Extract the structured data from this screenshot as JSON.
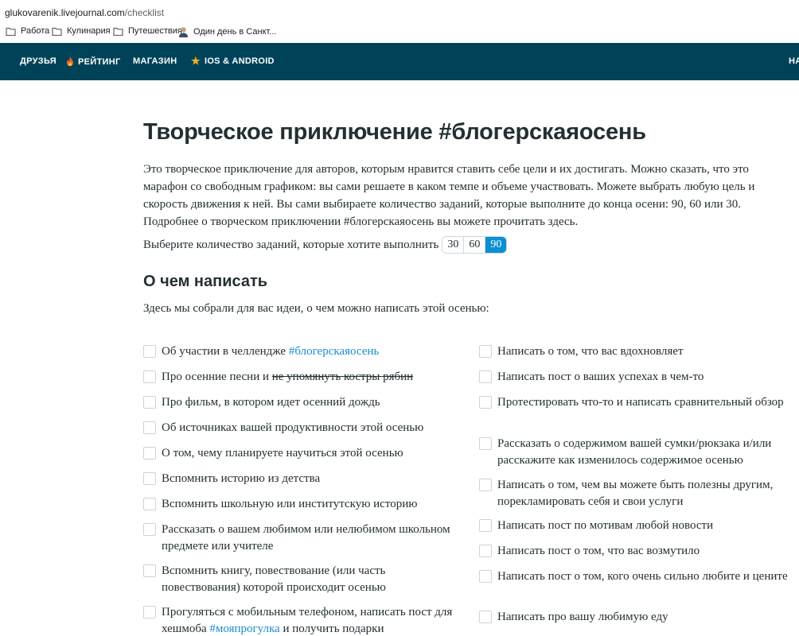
{
  "browser": {
    "url_host": "glukovarenik.livejournal.com",
    "url_path": "/checklist",
    "bookmarks": [
      "Работа",
      "Кулинария",
      "Путешествия",
      "Один день в Санкт..."
    ]
  },
  "nav": {
    "items": [
      "ДРУЗЬЯ",
      "РЕЙТИНГ",
      "МАГАЗИН",
      "IOS & ANDROID"
    ],
    "right_fragment": "НА"
  },
  "page": {
    "title": "Творческое приключение #блогерскаяосень",
    "intro": [
      "Это творческое приключение для авторов, которым нравится ставить себе цели и их достигать. Можно сказать, что это марафон со свободным графиком: вы сами решаете в каком темпе и объеме участвовать. Можете выбрать любую цель и скорость движения к ней. Вы сами выбираете количество заданий, которые выполните до конца осени: 90, 60 или 30.",
      "Подробнее о творческом приключении #блогерскаяосень вы можете прочитать здесь."
    ],
    "chooser": {
      "label": "Выберите количество заданий, которые хотите выполнить",
      "options": [
        "30",
        "60",
        "90"
      ],
      "selected": "90"
    },
    "section_title": "О чем написать",
    "section_lead": "Здесь мы собрали для вас идеи, о чем можно написать этой осенью:"
  },
  "checklist": {
    "left": [
      {
        "text": "Об участии в челлендже ",
        "tag": "#блогерскаяосень",
        "checked": false
      },
      {
        "text": "Про осенние песни и ",
        "strike": "не упомянуть костры рябин",
        "checked": false
      },
      {
        "text": "Про фильм, в котором идет осенний дождь",
        "checked": false
      },
      {
        "text": "Об источниках вашей продуктивности этой осенью",
        "checked": false
      },
      {
        "text": "О том, чему планируете научиться этой осенью",
        "checked": false
      },
      {
        "text": "Вспомнить историю из детства",
        "checked": false
      },
      {
        "text": "Вспомнить школьную или институтскую историю",
        "checked": false
      },
      {
        "text": "Рассказать о вашем любимом или нелюбимом школьном предмете или учителе",
        "checked": false
      },
      {
        "text": "Вспомнить книгу, повествование (или часть повествования) которой происходит осенью",
        "checked": false
      },
      {
        "text": "Прогуляться с мобильным телефоном, написать пост для хешмоба ",
        "tag": "#мояпрогулка",
        "after": " и получить подарки",
        "checked": false
      }
    ],
    "right": [
      {
        "text": "Написать о том, что вас вдохновляет",
        "checked": false
      },
      {
        "text": "Написать пост о ваших успехах в чем-то",
        "checked": false
      },
      {
        "text": "Протестировать что-то и написать сравнительный обзор",
        "checked": false
      },
      {
        "text": "Рассказать о содержимом вашей сумки/рюкзака и/или расскажите как изменилось содержимое осенью",
        "checked": false
      },
      {
        "text": "Написать о том, чем вы можете быть полезны другим, порекламировать себя и свои услуги",
        "checked": false
      },
      {
        "text": "Написать пост по мотивам любой новости",
        "checked": false
      },
      {
        "text": "Написать пост о том, что вас возмутило",
        "checked": false
      },
      {
        "text": "Написать пост о том, кого очень сильно любите и цените",
        "checked": false
      },
      {
        "text": "Написать про вашу любимую еду",
        "checked": false
      }
    ]
  },
  "colors": {
    "nav_bg": "#004359",
    "accent": "#0d8fd4",
    "link": "#1c8dcc"
  }
}
